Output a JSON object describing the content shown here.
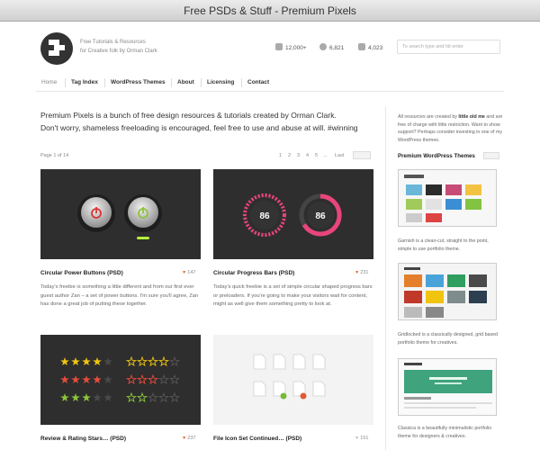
{
  "window": {
    "title": "Free PSDs & Stuff - Premium Pixels"
  },
  "header": {
    "tagline_line1": "Free Tutorials & Resources",
    "tagline_line2": "for Creative folk by Orman Clark",
    "stats": [
      {
        "icon": "rss-icon",
        "value": "12,000+"
      },
      {
        "icon": "twitter-bird-icon",
        "value": "6,821"
      },
      {
        "icon": "facebook-icon",
        "value": "4,023"
      }
    ],
    "search_placeholder": "To search type and hit enter"
  },
  "nav": {
    "items": [
      {
        "label": "Home",
        "active": true
      },
      {
        "label": "Tag Index",
        "active": false
      },
      {
        "label": "WordPress Themes",
        "active": false
      },
      {
        "label": "About",
        "active": false
      },
      {
        "label": "Licensing",
        "active": false
      },
      {
        "label": "Contact",
        "active": false
      }
    ]
  },
  "intro": {
    "line1": "Premium Pixels is a bunch of free design resources & tutorials created by Orman Clark.",
    "line2": "Don't worry, shameless freeloading is encouraged, feel free to use and abuse at will. #winning"
  },
  "pagination": {
    "info": "Page 1 of 14",
    "pages": [
      "1",
      "2",
      "3",
      "4",
      "5",
      "..."
    ],
    "last": "Last"
  },
  "posts": [
    {
      "title": "Circular Power Buttons (PSD)",
      "likes": "147",
      "excerpt": "Today's freebie is something a little different and from our first ever guest author Zan – a set of power buttons. I'm sure you'll agree, Zan has done a great job of putting these together."
    },
    {
      "title": "Circular Progress Bars (PSD)",
      "likes": "231",
      "excerpt": "Today's quick freebie is a set of simple circular shaped progress bars or preloaders. If you're going to make your visitors wait for content, might as well give them something pretty to look at.",
      "gauge_values": [
        "86",
        "86"
      ]
    },
    {
      "title": "Review & Rating Stars… (PSD)",
      "likes": "237"
    },
    {
      "title": "File Icon Set Continued… (PSD)",
      "likes": "151"
    }
  ],
  "sidebar": {
    "note_pre": "All resources are created by ",
    "note_bold": "little old me",
    "note_post": " and are free of charge with little restriction. Want to show support? Perhaps consider investing in one of my WordPress themes.",
    "themes_heading": "Premium WordPress Themes",
    "themes": [
      {
        "name": "Garnish",
        "desc": "Garnish is a clean-cut, straight to the point, simple to use portfolio theme."
      },
      {
        "name": "Gridlocked",
        "desc": "Gridlocked is a classically designed, grid based portfolio theme for creatives."
      },
      {
        "name": "Classica",
        "desc": "Classica is a beautifully minimalistic portfolio theme for designers & creatives."
      }
    ]
  },
  "colors": {
    "accent": "#e0662a",
    "progress_pink": "#e8457a",
    "power_green": "#9fd13a"
  }
}
